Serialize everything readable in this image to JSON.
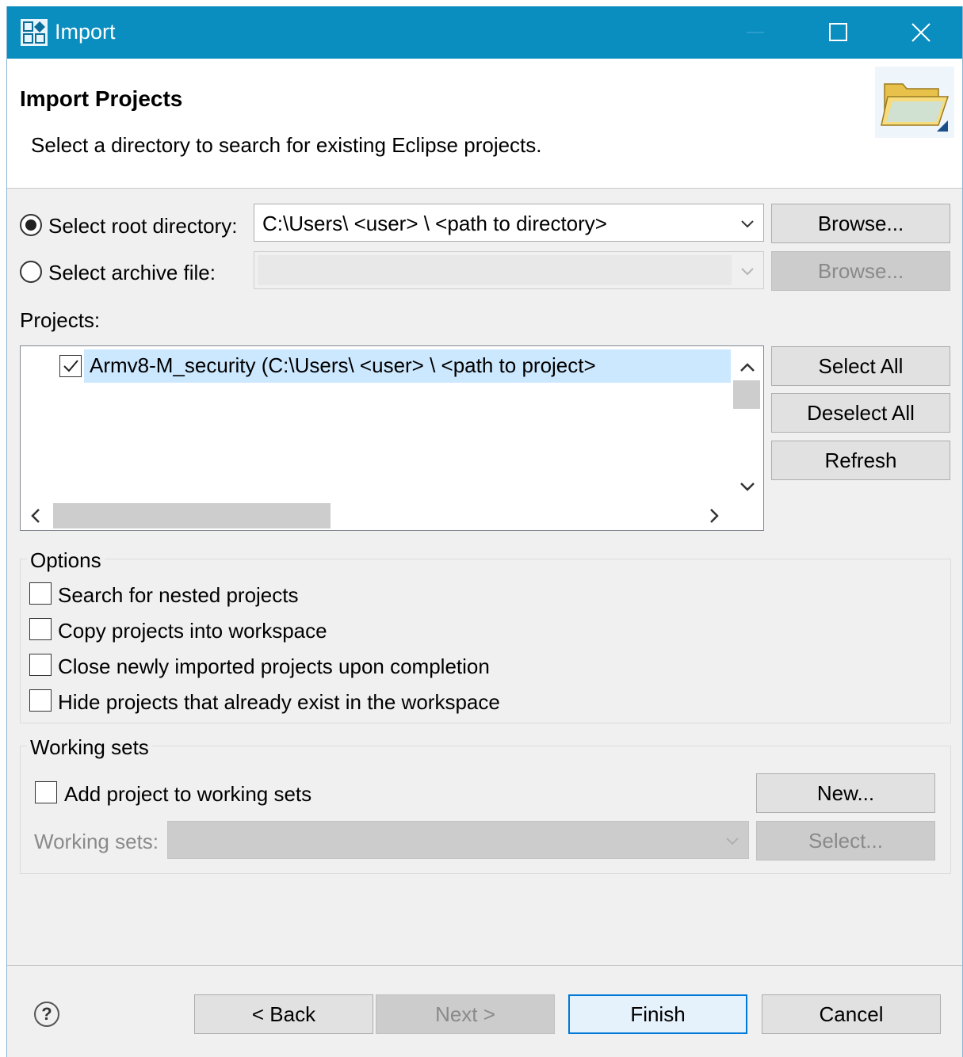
{
  "window": {
    "title": "Import",
    "app_icon": "import-app-icon",
    "title_color": "#0a8dbf"
  },
  "header": {
    "title": "Import Projects",
    "description": "Select a directory to search for existing Eclipse projects.",
    "icon": "open-folder-icon"
  },
  "source": {
    "root_dir_label": "Select root directory:",
    "root_dir_selected": true,
    "root_dir_value": "C:\\Users\\  <user>  \\    <path to directory>",
    "root_browse_label": "Browse...",
    "archive_label": "Select archive file:",
    "archive_selected": false,
    "archive_value": "",
    "archive_browse_label": "Browse..."
  },
  "projects": {
    "label": "Projects:",
    "items": [
      {
        "checked": true,
        "label": "Armv8-M_security (C:\\Users\\  <user>  \\    <path to project>"
      }
    ],
    "select_all_label": "Select All",
    "deselect_all_label": "Deselect All",
    "refresh_label": "Refresh"
  },
  "options": {
    "title": "Options",
    "items": [
      {
        "label": "Search for nested projects",
        "checked": false
      },
      {
        "label": "Copy projects into workspace",
        "checked": false
      },
      {
        "label": "Close newly imported projects upon completion",
        "checked": false
      },
      {
        "label": "Hide projects that already exist in the workspace",
        "checked": false
      }
    ]
  },
  "working_sets": {
    "title": "Working sets",
    "add_label": "Add project to working sets",
    "add_checked": false,
    "new_label": "New...",
    "sets_label": "Working sets:",
    "select_label": "Select..."
  },
  "footer": {
    "help_icon": "help-icon",
    "back_label": "< Back",
    "next_label": "Next >",
    "finish_label": "Finish",
    "cancel_label": "Cancel"
  }
}
